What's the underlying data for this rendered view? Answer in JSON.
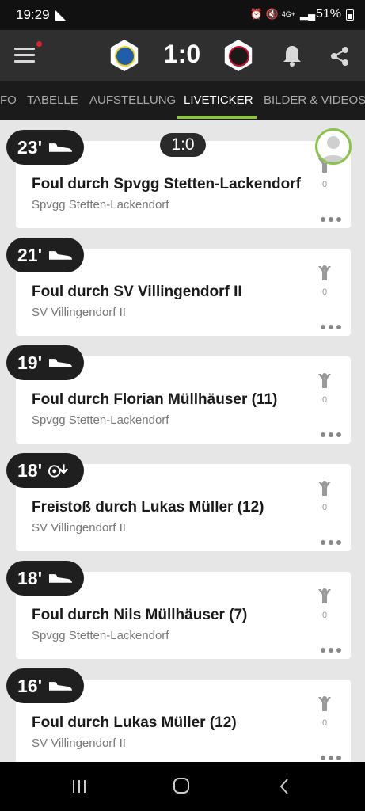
{
  "status_bar": {
    "time": "19:29",
    "network": "4G+",
    "battery": "51%"
  },
  "header": {
    "score": "1:0",
    "home_crest": "home-team-crest",
    "away_crest": "away-team-crest"
  },
  "tabs": [
    {
      "label": "FO"
    },
    {
      "label": "TABELLE"
    },
    {
      "label": "AUFSTELLUNG"
    },
    {
      "label": "LIVETICKER"
    },
    {
      "label": "BILDER & VIDEOS"
    }
  ],
  "active_tab": "LIVETICKER",
  "live_score_chip": "1:0",
  "events": [
    {
      "minute": "23'",
      "icon": "foul-boot-icon",
      "title": "Foul durch Spvgg Stetten-Lackendorf",
      "team": "Spvgg Stetten-Lackendorf",
      "likes": "0"
    },
    {
      "minute": "21'",
      "icon": "foul-boot-icon",
      "title": "Foul durch SV Villingendorf II",
      "team": "SV Villingendorf II",
      "likes": "0"
    },
    {
      "minute": "19'",
      "icon": "foul-boot-icon",
      "title": "Foul durch Florian Müllhäuser (11)",
      "team": "Spvgg Stetten-Lackendorf",
      "likes": "0"
    },
    {
      "minute": "18'",
      "icon": "free-kick-icon",
      "title": "Freistoß durch Lukas Müller (12)",
      "team": "SV Villingendorf II",
      "likes": "0"
    },
    {
      "minute": "18'",
      "icon": "foul-boot-icon",
      "title": "Foul durch Nils Müllhäuser (7)",
      "team": "Spvgg Stetten-Lackendorf",
      "likes": "0"
    },
    {
      "minute": "16'",
      "icon": "foul-boot-icon",
      "title": "Foul durch Lukas Müller (12)",
      "team": "SV Villingendorf II",
      "likes": "0"
    }
  ],
  "colors": {
    "accent": "#8bc34a",
    "header_bg": "#2f2f2f",
    "badge_bg": "#1f1f1f",
    "notification": "#e0232a"
  }
}
